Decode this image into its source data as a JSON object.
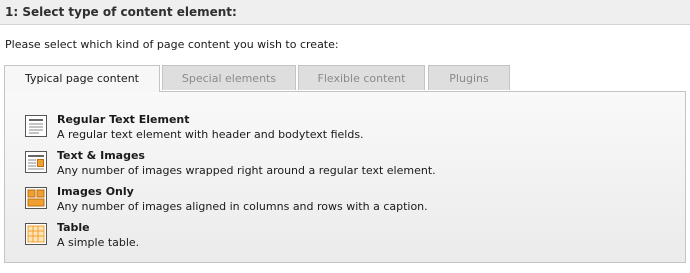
{
  "header": {
    "title": "1: Select type of content element:"
  },
  "instruction": "Please select which kind of page content you wish to create:",
  "tabs": [
    {
      "label": "Typical page content",
      "active": true
    },
    {
      "label": "Special elements",
      "active": false
    },
    {
      "label": "Flexible content",
      "active": false
    },
    {
      "label": "Plugins",
      "active": false
    }
  ],
  "elements": [
    {
      "title": "Regular Text Element",
      "description": "A regular text element with header and bodytext fields.",
      "icon": "text-element-icon"
    },
    {
      "title": "Text & Images",
      "description": "Any number of images wrapped right around a regular text element.",
      "icon": "text-images-icon"
    },
    {
      "title": "Images Only",
      "description": "Any number of images aligned in columns and rows with a caption.",
      "icon": "images-only-icon"
    },
    {
      "title": "Table",
      "description": "A simple table.",
      "icon": "table-icon"
    }
  ],
  "colors": {
    "icon_orange": "#f0a030",
    "icon_dark": "#555555",
    "active_tab": "#f7f7f7",
    "inactive_tab": "#dedede"
  }
}
